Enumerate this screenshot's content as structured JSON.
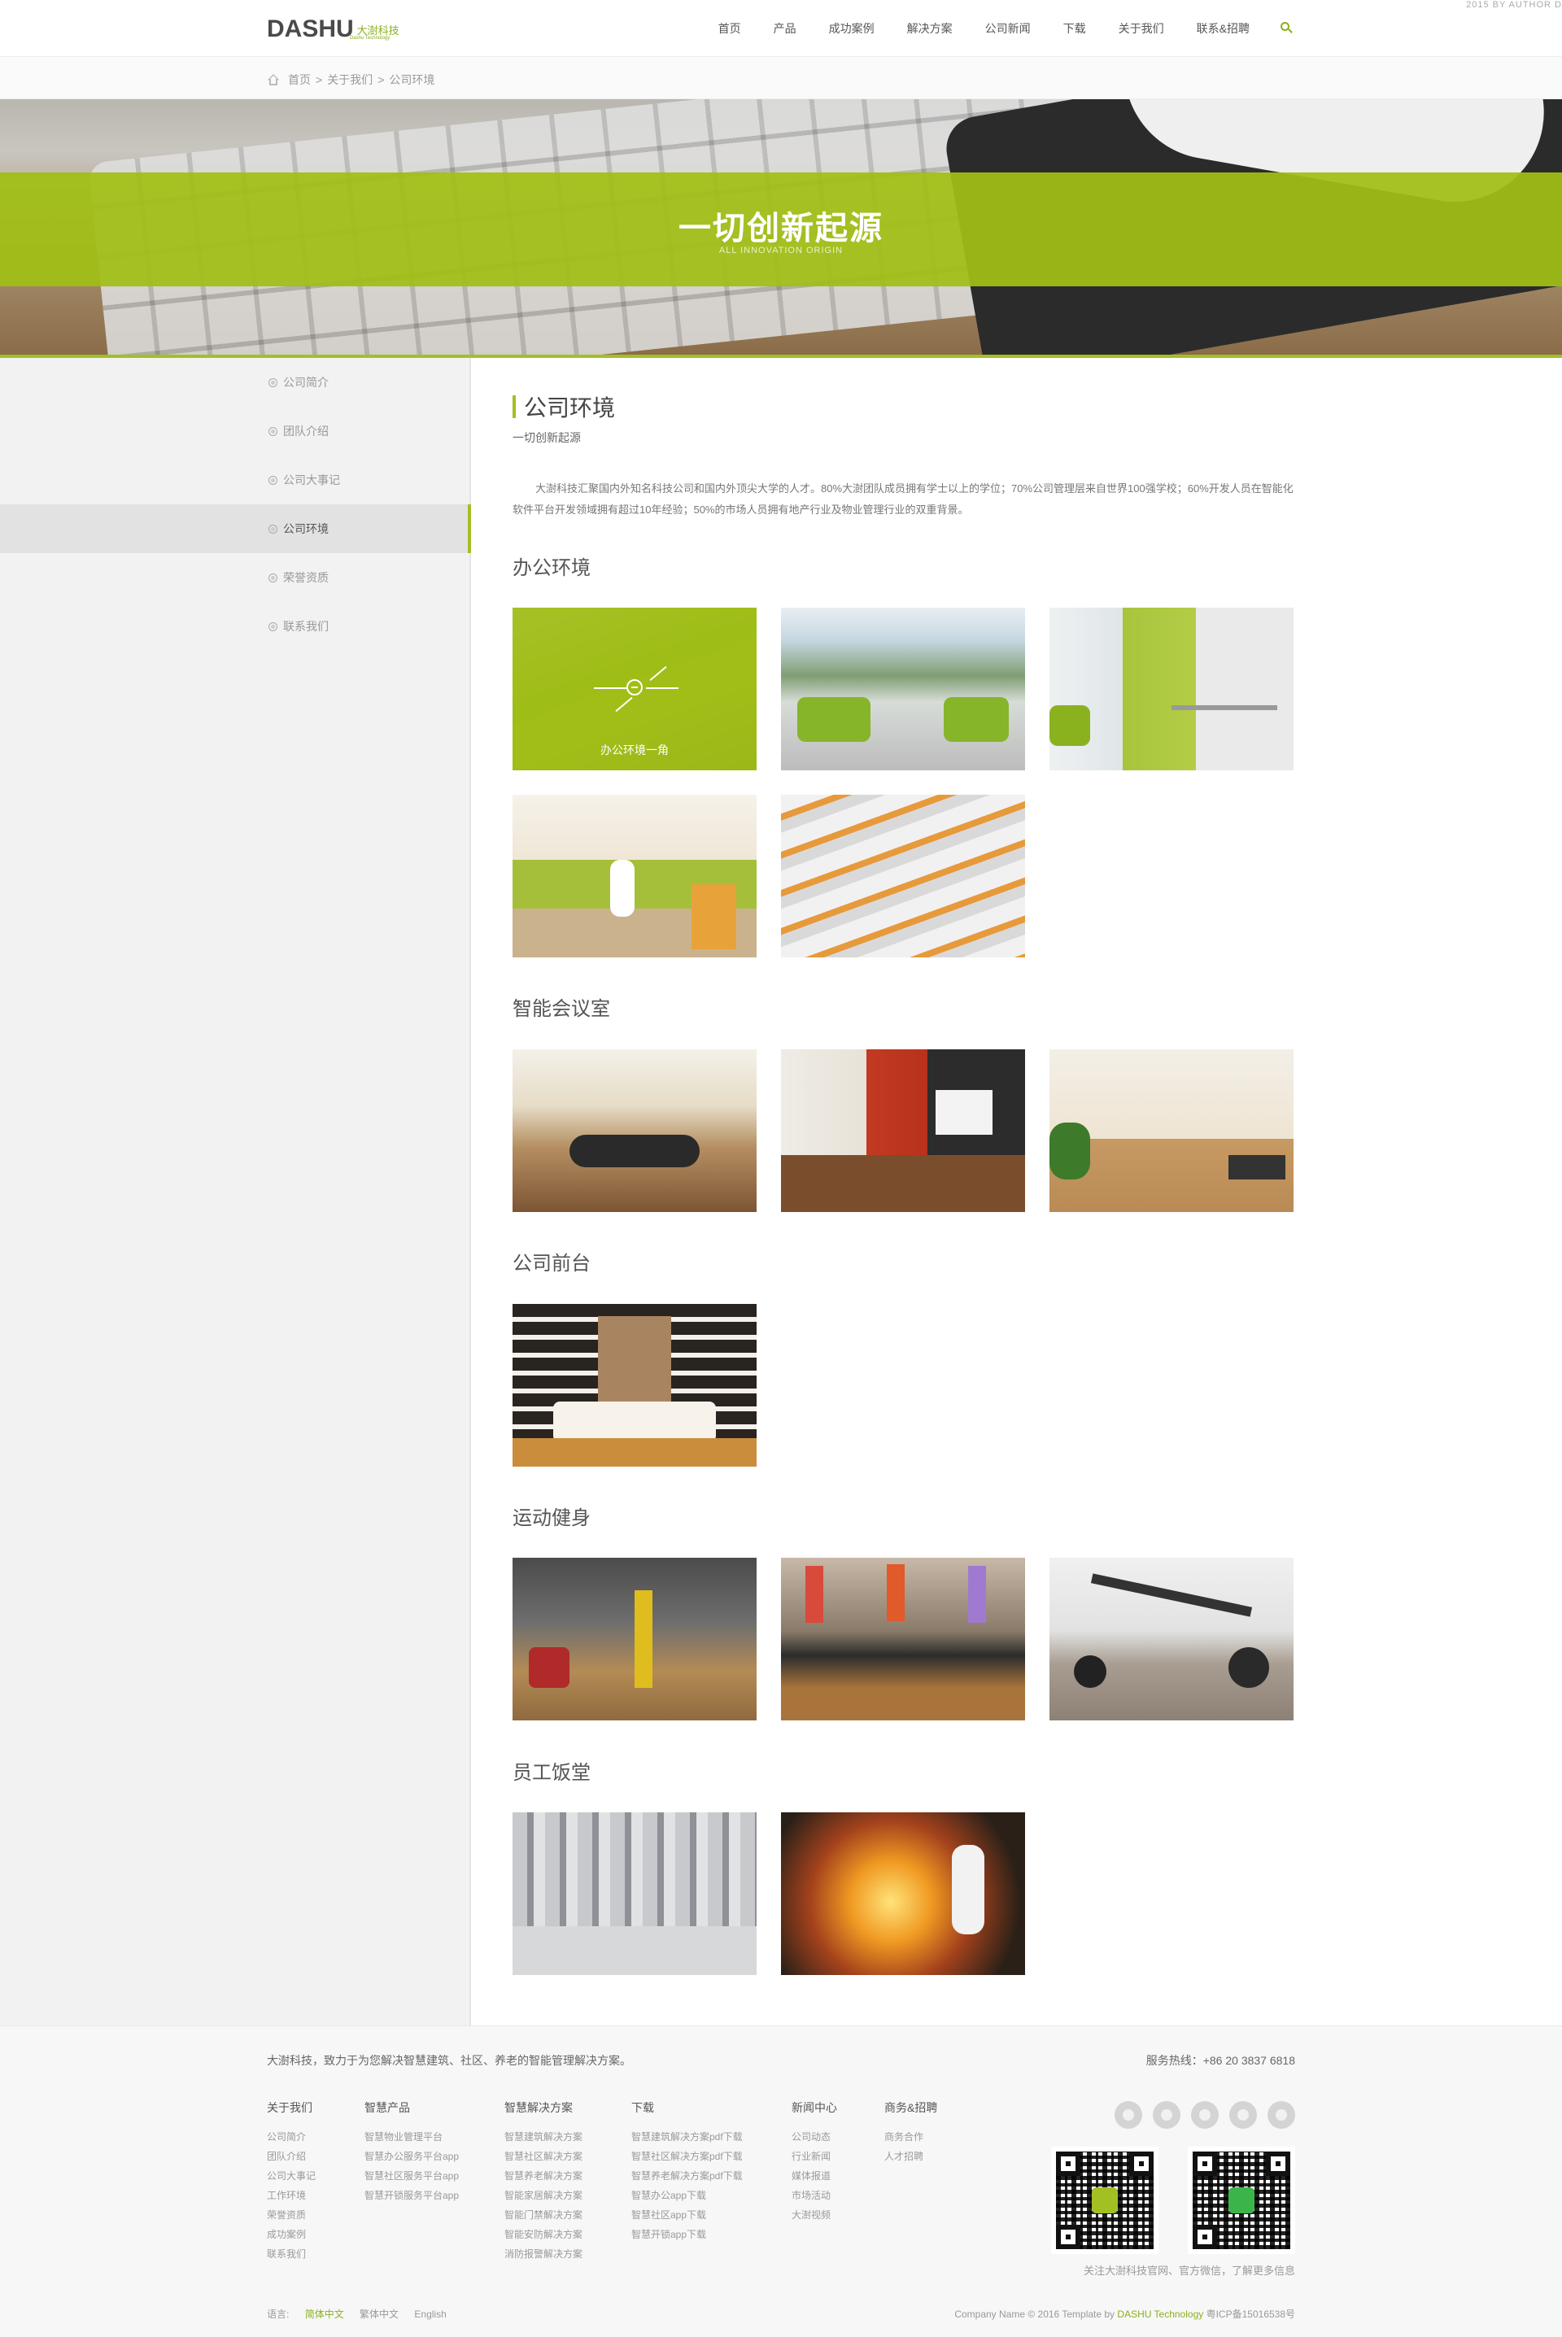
{
  "topline": "2015 BY AUTHOR D",
  "brand": {
    "name_en": "DASHU",
    "name_cn": "大澍科技",
    "tagline": "Dashu Technology"
  },
  "nav": [
    "首页",
    "产品",
    "成功案例",
    "解决方案",
    "公司新闻",
    "下载",
    "关于我们",
    "联系&招聘"
  ],
  "breadcrumb": [
    "首页",
    "关于我们",
    "公司环境"
  ],
  "banner": {
    "title": "一切创新起源",
    "subtitle": "ALL INNOVATION ORIGIN"
  },
  "sidebar": [
    "公司简介",
    "团队介绍",
    "公司大事记",
    "公司环境",
    "荣誉资质",
    "联系我们"
  ],
  "sidebar_active": "公司环境",
  "content": {
    "title": "公司环境",
    "subtitle": "一切创新起源",
    "intro": "大澍科技汇聚国内外知名科技公司和国内外顶尖大学的人才。80%大澍团队成员拥有学士以上的学位；70%公司管理层来自世界100强学校；60%开发人员在智能化软件平台开发领域拥有超过10年经验；50%的市场人员拥有地产行业及物业管理行业的双重背景。",
    "sections": [
      {
        "title": "办公环境",
        "hover_label": "办公环境一角"
      },
      {
        "title": "智能会议室"
      },
      {
        "title": "公司前台"
      },
      {
        "title": "运动健身"
      },
      {
        "title": "员工饭堂"
      }
    ]
  },
  "footer": {
    "slogan": "大澍科技，致力于为您解决智慧建筑、社区、养老的智能管理解决方案。",
    "hotline": "服务热线：+86 20 3837 6818",
    "columns": [
      {
        "title": "关于我们",
        "items": [
          "公司简介",
          "团队介绍",
          "公司大事记",
          "工作环境",
          "荣誉资质",
          "成功案例",
          "联系我们"
        ]
      },
      {
        "title": "智慧产品",
        "items": [
          "智慧物业管理平台",
          "智慧办公服务平台app",
          "智慧社区服务平台app",
          "智慧开锁服务平台app"
        ]
      },
      {
        "title": "智慧解决方案",
        "items": [
          "智慧建筑解决方案",
          "智慧社区解决方案",
          "智慧养老解决方案",
          "智能家居解决方案",
          "智能门禁解决方案",
          "智能安防解决方案",
          "消防报警解决方案"
        ]
      },
      {
        "title": "下载",
        "items": [
          "智慧建筑解决方案pdf下载",
          "智慧社区解决方案pdf下载",
          "智慧养老解决方案pdf下载",
          "智慧办公app下载",
          "智慧社区app下载",
          "智慧开锁app下载"
        ]
      },
      {
        "title": "新闻中心",
        "items": [
          "公司动态",
          "行业新闻",
          "媒体报道",
          "市场活动",
          "大澍视频"
        ]
      },
      {
        "title": "商务&招聘",
        "items": [
          "商务合作",
          "人才招聘"
        ]
      }
    ],
    "follow": "关注大澍科技官网、官方微信，了解更多信息",
    "languages": [
      "简体中文",
      "繁体中文",
      "English"
    ],
    "active_language": "简体中文",
    "copyright_prefix": "Company Name © 2016 Template by",
    "copyright_brand": "DASHU Technology",
    "icp": "粤ICP备15016538号"
  },
  "colors": {
    "accent": "#a3c023",
    "text": "#555555",
    "panel": "#f2f2f2"
  }
}
